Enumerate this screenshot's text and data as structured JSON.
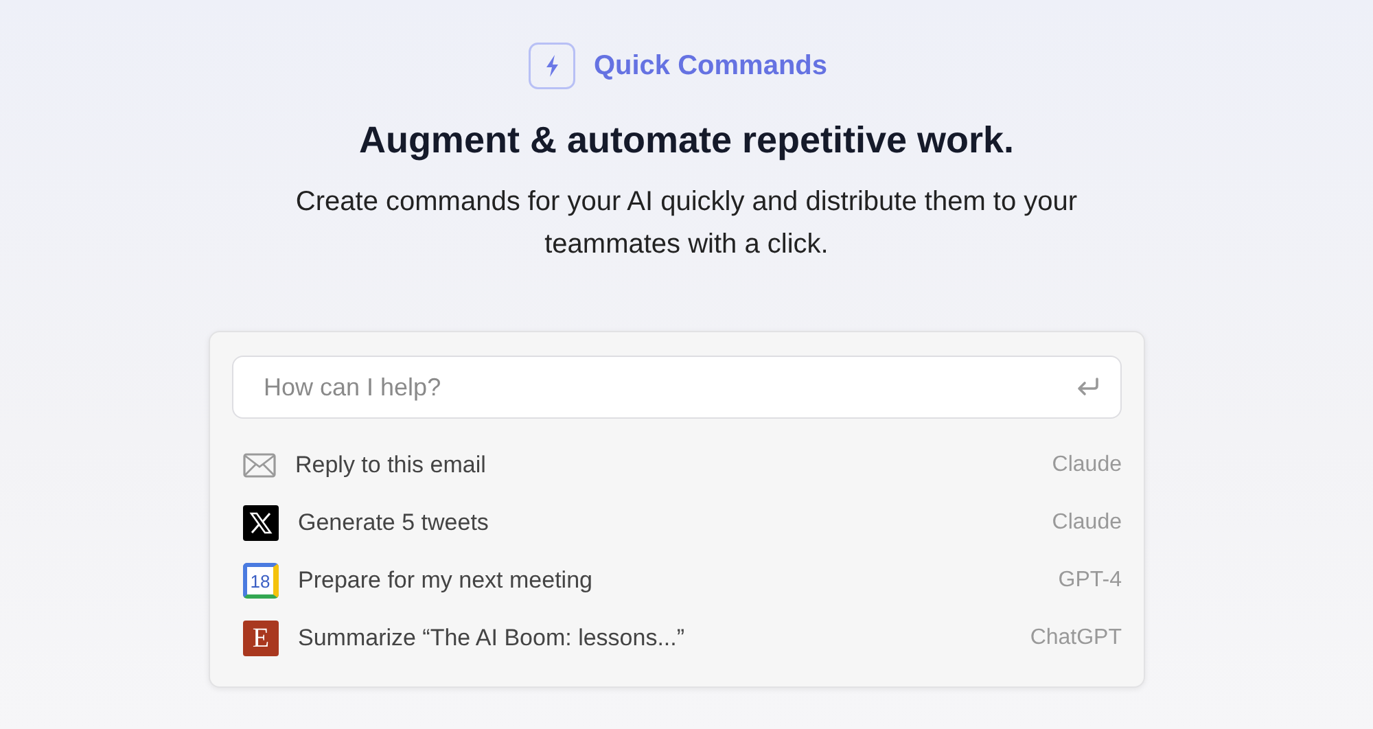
{
  "brand": {
    "name": "Quick Commands"
  },
  "headline": "Augment & automate repetitive work.",
  "subtitle": "Create commands for your AI quickly and distribute them to your teammates with a click.",
  "search": {
    "placeholder": "How can I help?"
  },
  "commands": [
    {
      "kind": "mail",
      "label": "Reply to this email",
      "model": "Claude"
    },
    {
      "kind": "x",
      "label": "Generate 5 tweets",
      "model": "Claude"
    },
    {
      "kind": "calendar",
      "icon_text": "18",
      "label": "Prepare for my next meeting",
      "model": "GPT-4"
    },
    {
      "kind": "letter",
      "icon_text": "E",
      "label": "Summarize “The AI Boom: lessons...”",
      "model": "ChatGPT"
    }
  ]
}
